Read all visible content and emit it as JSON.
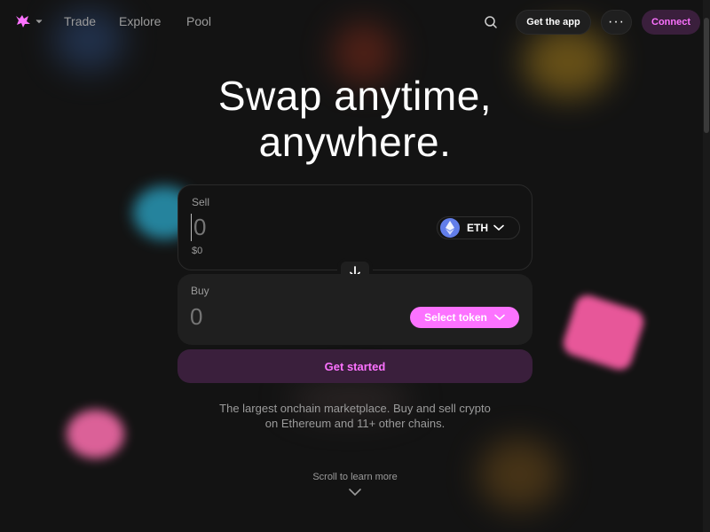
{
  "nav": {
    "links": [
      "Trade",
      "Explore",
      "Pool"
    ],
    "get_app_label": "Get the app",
    "more_label": "···",
    "connect_label": "Connect"
  },
  "hero": {
    "title_line1": "Swap anytime,",
    "title_line2": "anywhere."
  },
  "swap": {
    "sell": {
      "label": "Sell",
      "amount_placeholder": "0",
      "usd_value": "$0",
      "token": "ETH"
    },
    "buy": {
      "label": "Buy",
      "amount_placeholder": "0",
      "select_token_label": "Select token"
    },
    "cta_label": "Get started"
  },
  "description": {
    "line1": "The largest onchain marketplace. Buy and sell crypto",
    "line2": "on Ethereum and 11+ other chains."
  },
  "scroll_hint": "Scroll to learn more",
  "colors": {
    "background": "#131313",
    "accent_pink": "#fc72ff",
    "accent_dark": "#3a1f3c",
    "eth_blue": "#627eea",
    "muted_text": "#9b9b9b"
  },
  "icons": [
    "unicorn-logo-icon",
    "chevron-down-icon",
    "search-icon",
    "more-icon",
    "eth-icon",
    "arrow-down-icon"
  ]
}
